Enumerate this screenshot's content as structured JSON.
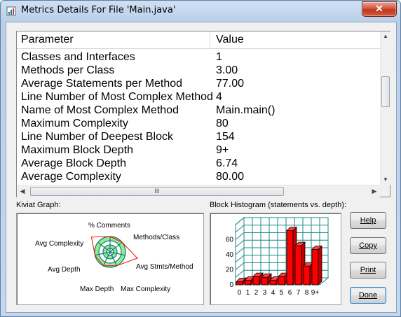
{
  "window": {
    "title": "Metrics Details For File 'Main.java'",
    "close_label": "✕"
  },
  "table": {
    "headers": [
      "Parameter",
      "Value"
    ],
    "rows": [
      [
        "Classes and Interfaces",
        "1"
      ],
      [
        "Methods per Class",
        "3.00"
      ],
      [
        "Average Statements per Method",
        "77.00"
      ],
      [
        "Line Number of Most Complex Method",
        "4"
      ],
      [
        "Name of Most Complex Method",
        "Main.main()"
      ],
      [
        "Maximum Complexity",
        "80"
      ],
      [
        "Line Number of Deepest Block",
        "154"
      ],
      [
        "Maximum Block Depth",
        "9+"
      ],
      [
        "Average Block Depth",
        "6.74"
      ],
      [
        "Average Complexity",
        "80.00"
      ]
    ],
    "hscroll_grip": "III"
  },
  "kiviat": {
    "label": "Kiviat Graph:",
    "axes": [
      "% Comments",
      "Methods/Class",
      "Avg Stmts/Method",
      "Max Complexity",
      "Max Depth",
      "Avg Depth",
      "Avg Complexity"
    ],
    "colors": {
      "ring_fill": "#90ee90",
      "ring_line": "#1a7a7a",
      "polygon": "#ff0000"
    }
  },
  "histogram": {
    "label": "Block Histogram (statements vs. depth):",
    "x_labels": [
      "0",
      "1",
      "2",
      "3",
      "4",
      "5",
      "6",
      "7",
      "8",
      "9+"
    ],
    "y_labels": [
      "0",
      "20",
      "40",
      "60"
    ],
    "bar_color": "#ff0000",
    "grid_color": "#1a8a8a"
  },
  "chart_data": {
    "type": "bar",
    "title": "Block Histogram (statements vs. depth):",
    "categories": [
      "0",
      "1",
      "2",
      "3",
      "4",
      "5",
      "6",
      "7",
      "8",
      "9+"
    ],
    "values": [
      4,
      6,
      11,
      10,
      6,
      11,
      72,
      52,
      25,
      47
    ],
    "ylim": [
      0,
      80
    ],
    "grid": true
  },
  "buttons": {
    "help": "Help",
    "copy": "Copy",
    "print": "Print",
    "done": "Done"
  }
}
